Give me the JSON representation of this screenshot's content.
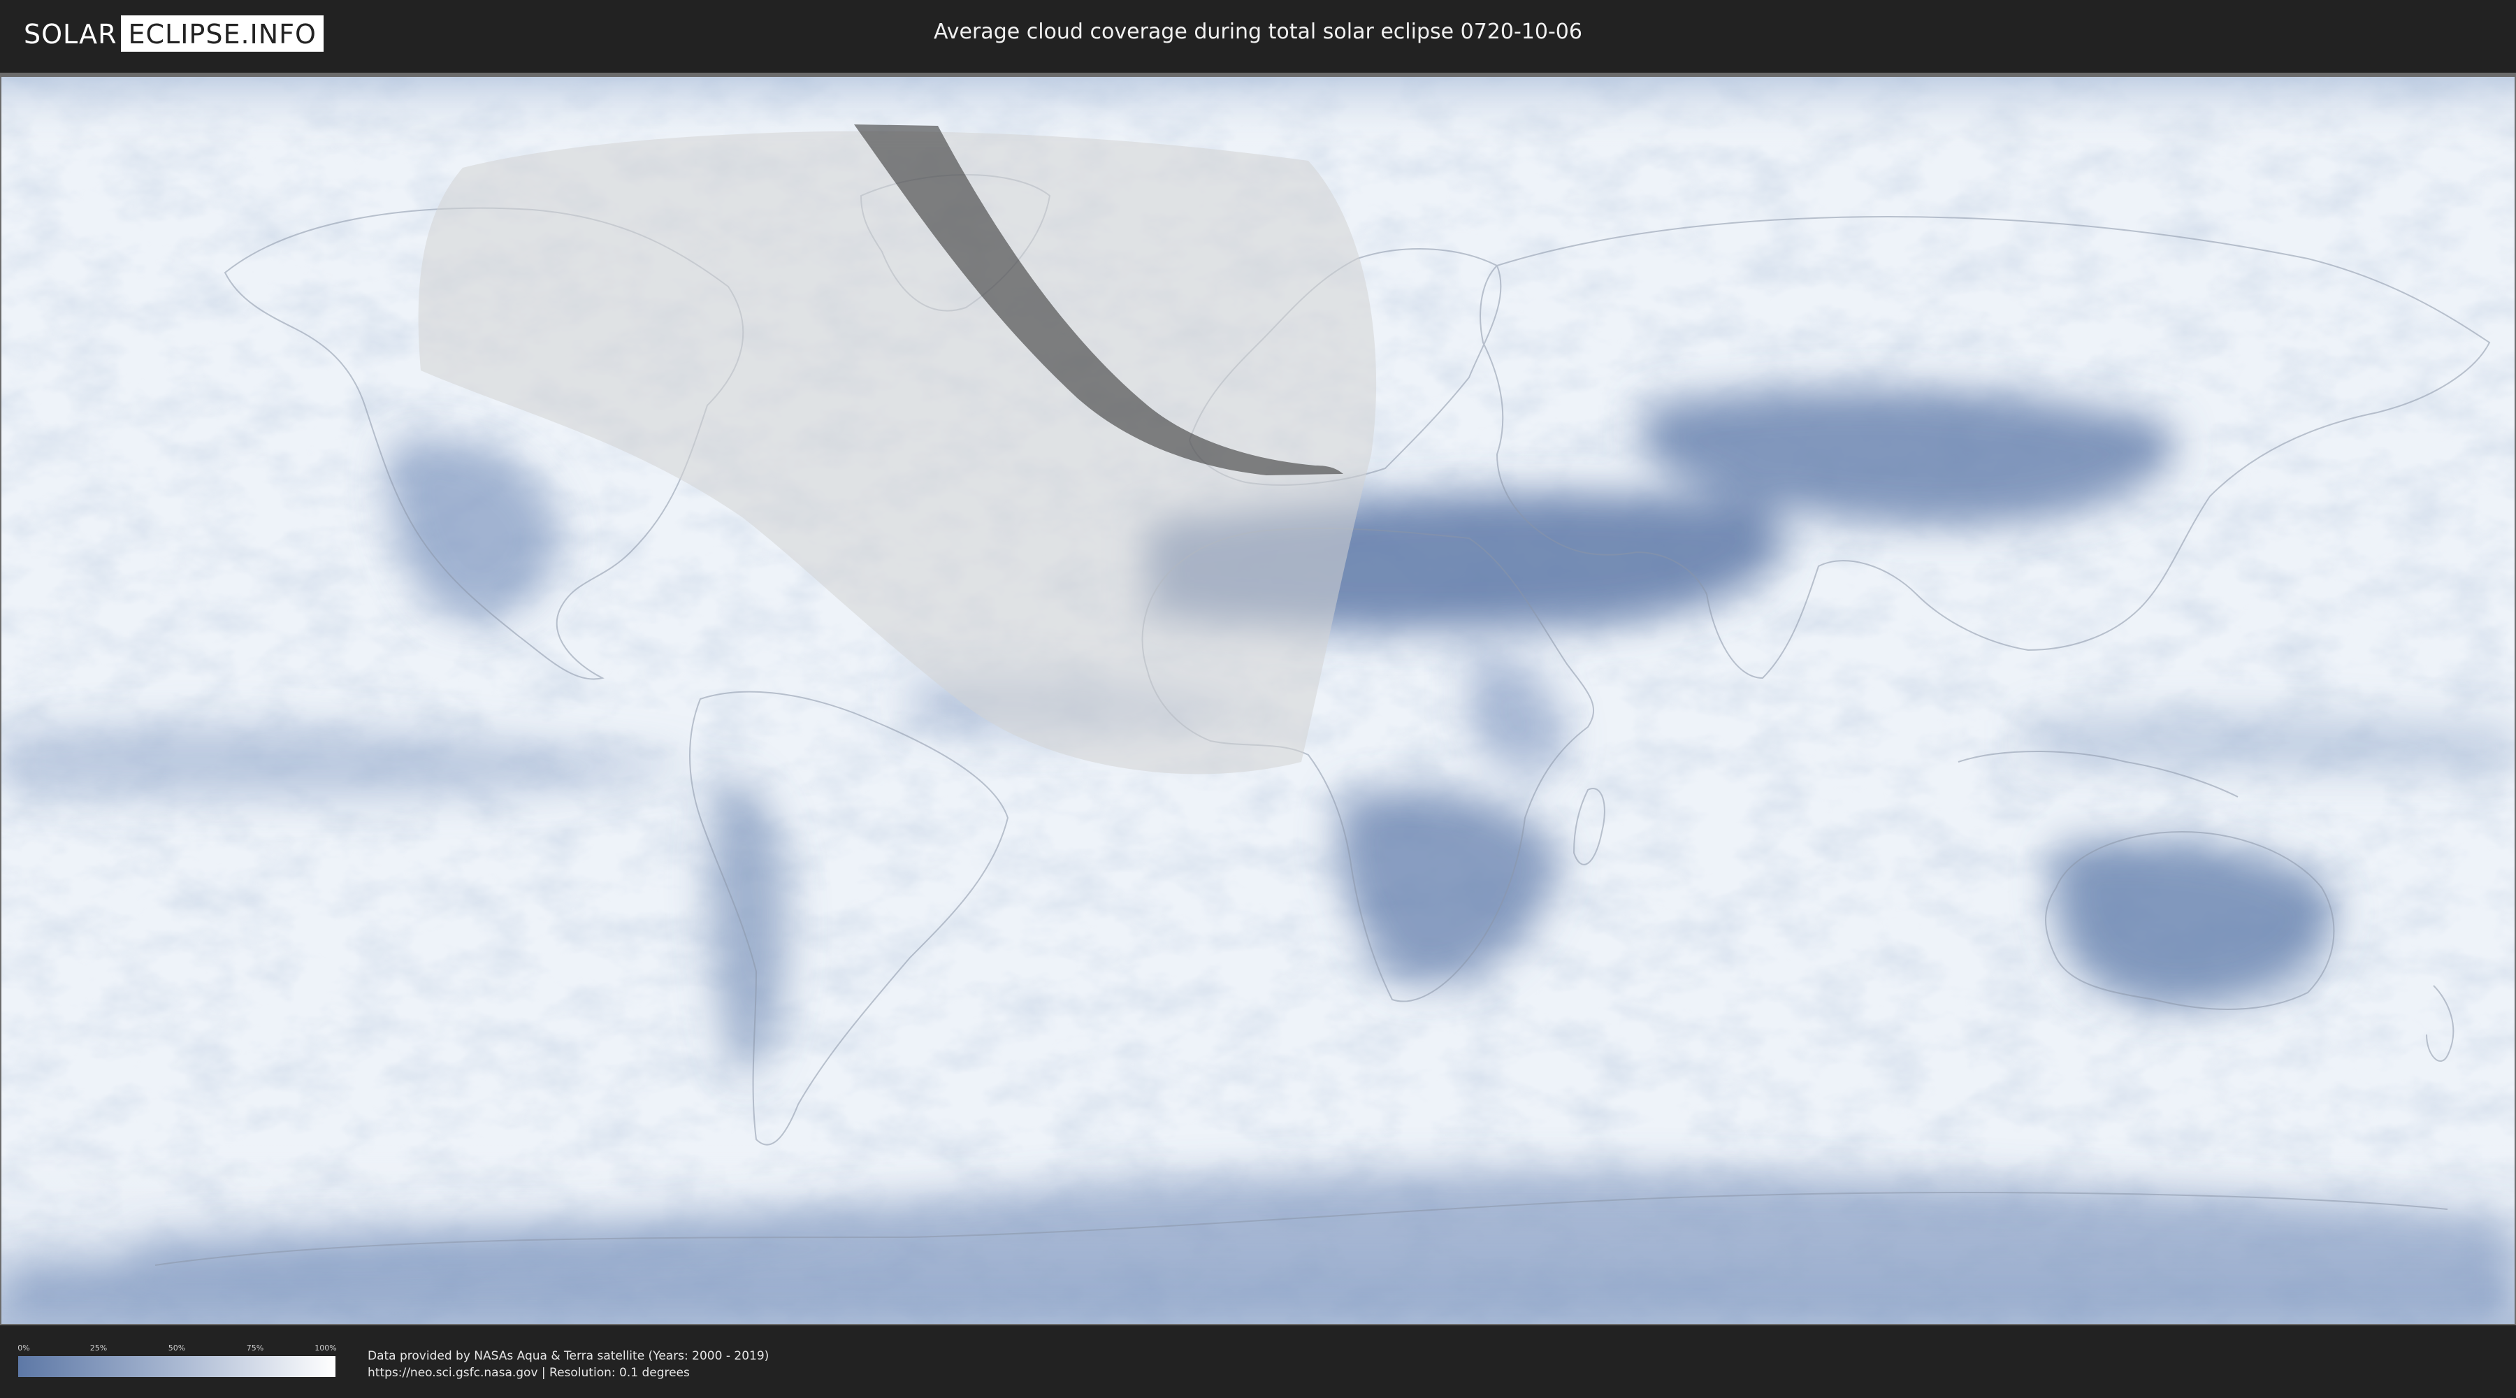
{
  "header": {
    "logo_left": "SOLAR",
    "logo_right": "ECLIPSE.INFO",
    "title": "Average cloud coverage during total solar eclipse 0720-10-06"
  },
  "legend": {
    "ticks": [
      "0%",
      "25%",
      "50%",
      "75%",
      "100%"
    ],
    "colors": {
      "low": "#5d78a6",
      "high": "#ffffff"
    }
  },
  "credits": {
    "line1": "Data provided by NASAs Aqua & Terra satellite (Years: 2000 - 2019)",
    "line2": "https://neo.sci.gsfc.nasa.gov | Resolution: 0.1 degrees"
  },
  "colors": {
    "page_bg": "#222222",
    "cloud_white": "#f4f7fb",
    "clear_sky_blue": "#5d78a6",
    "eclipse_shadow": "#cfcfcf",
    "totality_path": "#3a3a3a"
  }
}
